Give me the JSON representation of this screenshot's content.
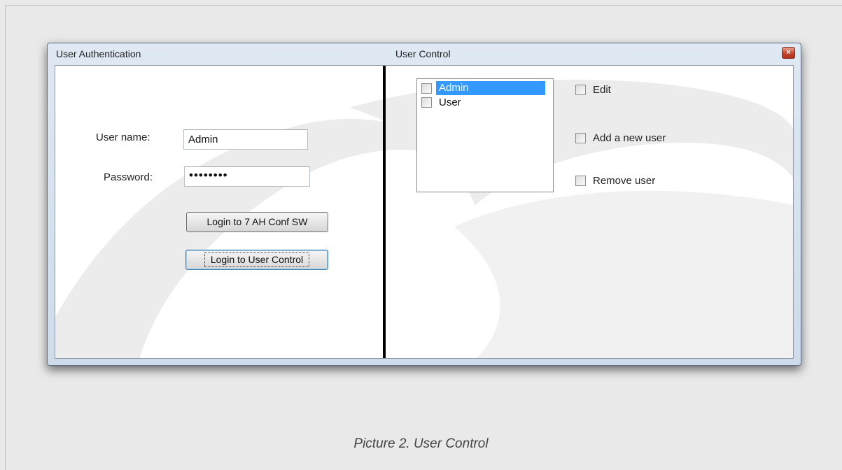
{
  "window": {
    "title_left": "User Authentication",
    "title_right": "User Control",
    "close_glyph": "×"
  },
  "auth": {
    "username_label": "User name:",
    "username_value": "Admin",
    "password_label": "Password:",
    "password_value": "••••••••",
    "login_conf_button": "Login to 7 AH Conf SW",
    "login_user_control_button": "Login to User Control"
  },
  "user_control": {
    "users": [
      {
        "label": "Admin",
        "selected": true,
        "checked": false
      },
      {
        "label": "User",
        "selected": false,
        "checked": false
      }
    ],
    "permissions": [
      {
        "label": "Edit",
        "checked": false
      },
      {
        "label": "Add a new user",
        "checked": false
      },
      {
        "label": "Remove user",
        "checked": false
      }
    ]
  },
  "caption": "Picture 2. User Control",
  "colors": {
    "selection": "#3399ff",
    "divider": "#000000",
    "close_button": "#c4432b"
  },
  "icons": {
    "close": "close-icon",
    "watermark": "logo-watermark"
  }
}
